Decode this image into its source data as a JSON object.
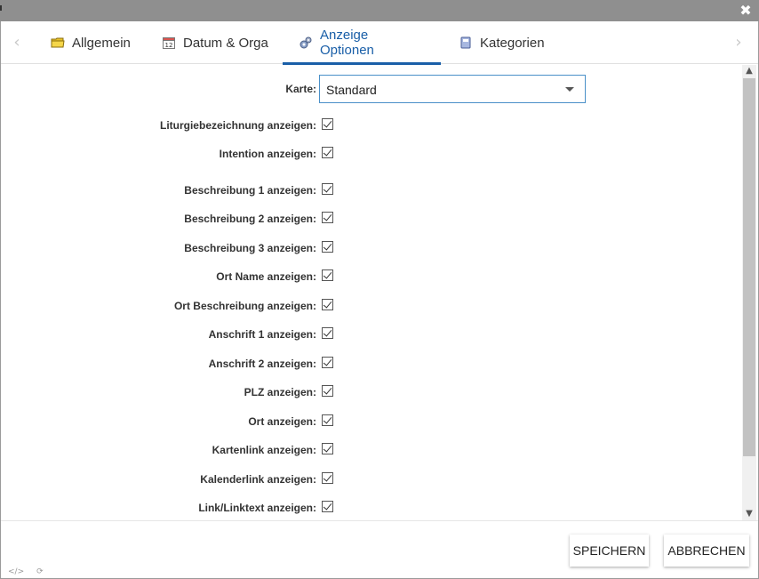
{
  "tabs": [
    {
      "label": "Allgemein",
      "icon": "folder-icon"
    },
    {
      "label": "Datum & Orga",
      "icon": "calendar-icon"
    },
    {
      "label": "Anzeige Optionen",
      "icon": "gears-icon",
      "active": true
    },
    {
      "label": "Kategorien",
      "icon": "book-icon"
    }
  ],
  "form": {
    "karte_label": "Karte:",
    "karte_value": "Standard",
    "options": [
      {
        "label": "Liturgiebezeichnung anzeigen:",
        "checked": true
      },
      {
        "label": "Intention anzeigen:",
        "checked": true
      },
      {
        "label": "Beschreibung 1 anzeigen:",
        "checked": true
      },
      {
        "label": "Beschreibung 2 anzeigen:",
        "checked": true
      },
      {
        "label": "Beschreibung 3 anzeigen:",
        "checked": true
      },
      {
        "label": "Ort Name anzeigen:",
        "checked": true
      },
      {
        "label": "Ort Beschreibung anzeigen:",
        "checked": true
      },
      {
        "label": "Anschrift 1 anzeigen:",
        "checked": true
      },
      {
        "label": "Anschrift 2 anzeigen:",
        "checked": true
      },
      {
        "label": "PLZ anzeigen:",
        "checked": true
      },
      {
        "label": "Ort anzeigen:",
        "checked": true
      },
      {
        "label": "Kartenlink anzeigen:",
        "checked": true
      },
      {
        "label": "Kalenderlink anzeigen:",
        "checked": true
      },
      {
        "label": "Link/Linktext anzeigen:",
        "checked": true
      }
    ]
  },
  "footer": {
    "save_label": "SPEICHERN",
    "cancel_label": "ABBRECHEN"
  },
  "colors": {
    "accent": "#1a5fa8"
  }
}
